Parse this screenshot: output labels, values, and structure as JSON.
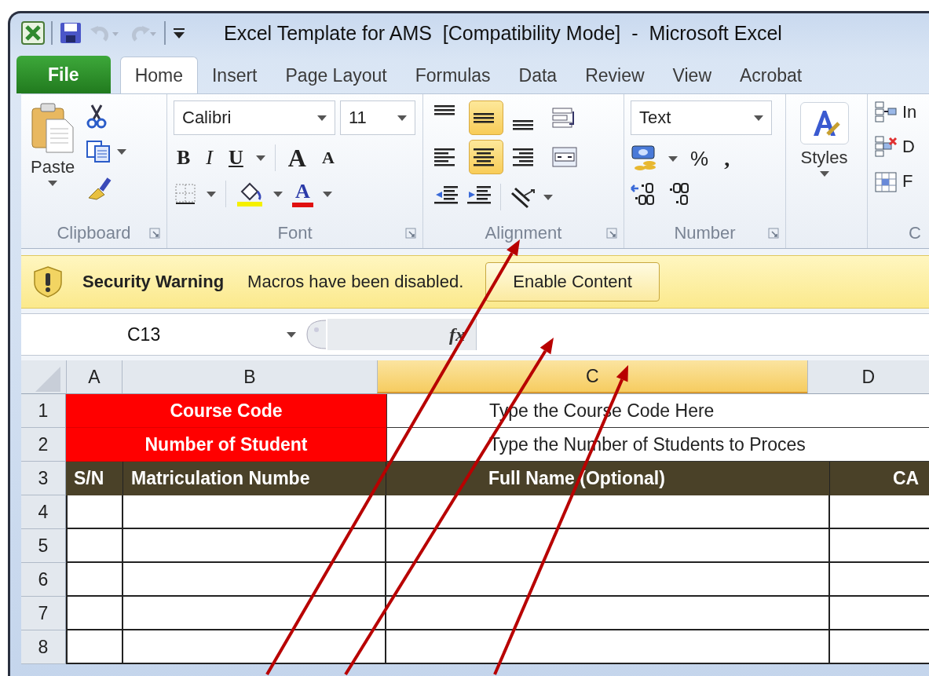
{
  "window": {
    "title": "Excel Template for AMS  [Compatibility Mode]  -  Microsoft Excel"
  },
  "tabs": [
    {
      "label": "File",
      "kind": "file",
      "selected": false
    },
    {
      "label": "Home",
      "kind": "tab",
      "selected": true
    },
    {
      "label": "Insert",
      "kind": "tab",
      "selected": false
    },
    {
      "label": "Page Layout",
      "kind": "tab",
      "selected": false
    },
    {
      "label": "Formulas",
      "kind": "tab",
      "selected": false
    },
    {
      "label": "Data",
      "kind": "tab",
      "selected": false
    },
    {
      "label": "Review",
      "kind": "tab",
      "selected": false
    },
    {
      "label": "View",
      "kind": "tab",
      "selected": false
    },
    {
      "label": "Acrobat",
      "kind": "tab",
      "selected": false
    }
  ],
  "ribbon": {
    "groups": [
      {
        "kind": "clipboard",
        "label": "Clipboard",
        "paste": "Paste"
      },
      {
        "kind": "font",
        "label": "Font",
        "font_name": "Calibri",
        "font_size": "11",
        "bold": "B",
        "italic": "I",
        "underline": "U",
        "grow": "A",
        "shrink": "A",
        "font_color": "A"
      },
      {
        "kind": "alignment",
        "label": "Alignment",
        "buttons": [
          {
            "kind": "top",
            "selected": false
          },
          {
            "kind": "middle",
            "selected": true
          },
          {
            "kind": "bottom",
            "selected": false
          },
          {
            "kind": "wrap",
            "selected": false
          },
          {
            "kind": "left",
            "selected": false
          },
          {
            "kind": "center",
            "selected": true
          },
          {
            "kind": "right",
            "selected": false
          },
          {
            "kind": "merge",
            "selected": false
          }
        ]
      },
      {
        "kind": "number",
        "label": "Number",
        "format": "Text",
        "percent": "%",
        "comma": ","
      },
      {
        "kind": "styles",
        "label": "Styles"
      },
      {
        "kind": "cells",
        "label": "C",
        "items": [
          "In",
          "D",
          "F"
        ]
      }
    ]
  },
  "security_bar": {
    "title": "Security Warning",
    "message": "Macros have been disabled.",
    "button": "Enable Content"
  },
  "formula_bar": {
    "name_box": "C13",
    "fx": "fx"
  },
  "sheet": {
    "columns": [
      {
        "label": "A",
        "selected": false
      },
      {
        "label": "B",
        "selected": false
      },
      {
        "label": "C",
        "selected": true
      },
      {
        "label": "D",
        "selected": false
      }
    ],
    "rows": [
      {
        "header": "1",
        "kind": "label",
        "cells": [
          "Course Code",
          "Type the Course Code Here"
        ]
      },
      {
        "header": "2",
        "kind": "label",
        "cells": [
          "Number of Student",
          "Type the Number of Students to Proces"
        ]
      },
      {
        "header": "3",
        "kind": "header",
        "cells": [
          "S/N",
          "Matriculation Numbe",
          "Full Name (Optional)",
          "CA"
        ]
      },
      {
        "header": "4",
        "kind": "blank"
      },
      {
        "header": "5",
        "kind": "blank"
      },
      {
        "header": "6",
        "kind": "blank"
      },
      {
        "header": "7",
        "kind": "blank"
      },
      {
        "header": "8",
        "kind": "blank"
      }
    ]
  },
  "annotation_arrows": [
    {
      "color": "#b80000"
    },
    {
      "color": "#b80000"
    },
    {
      "color": "#b80000"
    }
  ]
}
